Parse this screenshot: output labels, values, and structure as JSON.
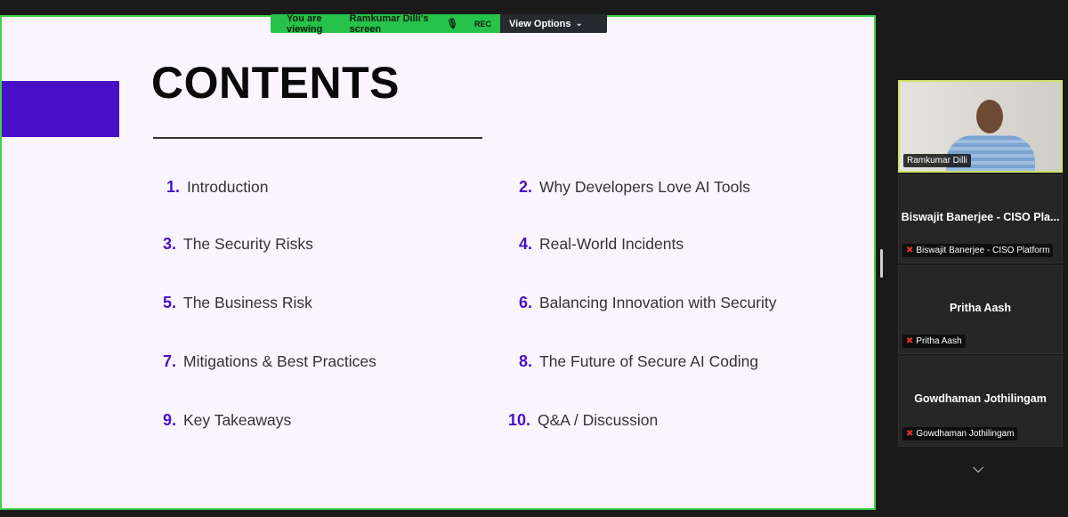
{
  "banner": {
    "viewing_prefix": "You are viewing",
    "presenter_screen": "Ramkumar Dilli's screen",
    "rec": "REC",
    "view_options": "View Options"
  },
  "slide": {
    "title": "CONTENTS",
    "items": [
      {
        "num": "1.",
        "label": "Introduction"
      },
      {
        "num": "2.",
        "label": "Why Developers Love AI Tools"
      },
      {
        "num": "3.",
        "label": "The Security Risks"
      },
      {
        "num": "4.",
        "label": "Real-World Incidents"
      },
      {
        "num": "5.",
        "label": "The Business Risk"
      },
      {
        "num": "6.",
        "label": "Balancing Innovation with Security"
      },
      {
        "num": "7.",
        "label": "Mitigations & Best Practices"
      },
      {
        "num": "8.",
        "label": "The Future of Secure AI Coding"
      },
      {
        "num": "9.",
        "label": "Key Takeaways"
      },
      {
        "num": "10.",
        "label": "Q&A / Discussion"
      }
    ]
  },
  "participants": [
    {
      "name": "Ramkumar Dilli",
      "video": true
    },
    {
      "display": "Biswajit Banerjee - CISO Pla...",
      "name": "Biswajit Banerjee - CISO Platform",
      "muted": true
    },
    {
      "display": "Pritha Aash",
      "name": "Pritha Aash",
      "muted": true
    },
    {
      "display": "Gowdhaman Jothilingam",
      "name": "Gowdhaman Jothilingam",
      "muted": true
    }
  ],
  "colors": {
    "accent_purple": "#4a10c8",
    "share_border": "#3fd14a",
    "banner_green": "#26c24a",
    "slide_bg": "#faf5fc"
  },
  "icons": {
    "mic_muted": "mic-muted-icon",
    "chevron_down": "chevron-down-icon"
  }
}
